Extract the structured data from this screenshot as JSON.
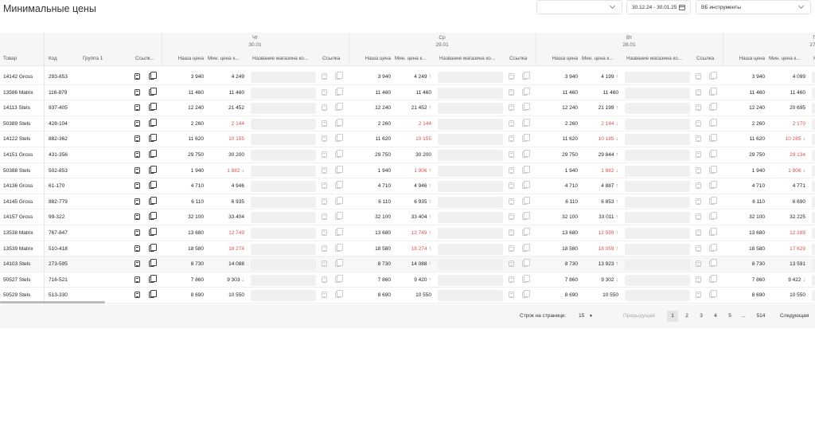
{
  "page": {
    "title": "Минимальные цены"
  },
  "filters": {
    "store_select": "",
    "date_range": "30.12.24 - 30.01.25",
    "category_select": "ВБ инструменты"
  },
  "icons": [
    "chevron-down-icon",
    "calendar-icon",
    "link-doc-icon",
    "copy-icon"
  ],
  "columns": {
    "product": "Товар",
    "code": "Код",
    "group": "Группа 1",
    "link": "Ссылк...",
    "our_price": "Наша цена",
    "min_price": "Мин. цена к...",
    "store_name": "Название магазина ко...",
    "store_link": "Ссылка"
  },
  "days": [
    {
      "name": "Чт",
      "date": "30.01"
    },
    {
      "name": "Ср",
      "date": "29.01"
    },
    {
      "name": "Вт",
      "date": "28.01"
    },
    {
      "name": "Пн",
      "date": "27.01"
    }
  ],
  "rows": [
    {
      "product": "14142 Gross",
      "code": "293-853",
      "d": [
        [
          "3 940",
          "4 249",
          ""
        ],
        [
          "3 940",
          "4 249",
          "↑"
        ],
        [
          "3 940",
          "4 199",
          "↑"
        ],
        [
          "3 940",
          "4 099",
          ""
        ]
      ],
      "red": [
        false,
        false,
        false,
        false
      ]
    },
    {
      "product": "13586 Matrix",
      "code": "116-879",
      "d": [
        [
          "11 460",
          "11 460",
          ""
        ],
        [
          "11 460",
          "11 460",
          ""
        ],
        [
          "11 460",
          "11 460",
          ""
        ],
        [
          "11 460",
          "11 460",
          ""
        ]
      ],
      "red": [
        false,
        false,
        false,
        false
      ]
    },
    {
      "product": "14113 Stels",
      "code": "937-405",
      "d": [
        [
          "12 240",
          "21 452",
          ""
        ],
        [
          "12 240",
          "21 452",
          "↑"
        ],
        [
          "12 240",
          "21 199",
          "↑"
        ],
        [
          "12 240",
          "20 695",
          ""
        ]
      ],
      "red": [
        false,
        false,
        false,
        false
      ]
    },
    {
      "product": "50389 Stels",
      "code": "428-104",
      "d": [
        [
          "2 260",
          "2 144",
          ""
        ],
        [
          "2 260",
          "2 144",
          ""
        ],
        [
          "2 260",
          "2 144",
          "↓"
        ],
        [
          "2 260",
          "2 170",
          ""
        ]
      ],
      "red": [
        true,
        true,
        true,
        true
      ]
    },
    {
      "product": "14122 Stels",
      "code": "882-362",
      "d": [
        [
          "11 620",
          "10 155",
          ""
        ],
        [
          "11 620",
          "10 155",
          ""
        ],
        [
          "11 620",
          "10 185",
          "↓"
        ],
        [
          "11 620",
          "10 285",
          "↓"
        ]
      ],
      "red": [
        true,
        true,
        true,
        true
      ]
    },
    {
      "product": "14151 Gross",
      "code": "431-356",
      "d": [
        [
          "29 750",
          "30 200",
          ""
        ],
        [
          "29 750",
          "30 200",
          ""
        ],
        [
          "29 750",
          "29 844",
          "↑"
        ],
        [
          "29 750",
          "29 134",
          ""
        ]
      ],
      "red": [
        false,
        false,
        false,
        true
      ]
    },
    {
      "product": "50388 Stels",
      "code": "502-853",
      "d": [
        [
          "1 940",
          "1 882",
          "↓"
        ],
        [
          "1 940",
          "1 906",
          "↑"
        ],
        [
          "1 940",
          "1 882",
          "↓"
        ],
        [
          "1 940",
          "1 906",
          "↓"
        ]
      ],
      "red": [
        true,
        true,
        true,
        true
      ]
    },
    {
      "product": "14136 Gross",
      "code": "61-170",
      "d": [
        [
          "4 710",
          "4 946",
          ""
        ],
        [
          "4 710",
          "4 946",
          "↑"
        ],
        [
          "4 710",
          "4 887",
          "↑"
        ],
        [
          "4 710",
          "4 771",
          ""
        ]
      ],
      "red": [
        false,
        false,
        false,
        false
      ]
    },
    {
      "product": "14145 Gross",
      "code": "882-779",
      "d": [
        [
          "6 110",
          "6 935",
          ""
        ],
        [
          "6 110",
          "6 935",
          "↑"
        ],
        [
          "6 110",
          "6 853",
          "↑"
        ],
        [
          "6 110",
          "6 690",
          ""
        ]
      ],
      "red": [
        false,
        false,
        false,
        false
      ]
    },
    {
      "product": "14157 Gross",
      "code": "99-322",
      "d": [
        [
          "32 100",
          "33 404",
          ""
        ],
        [
          "32 100",
          "33 404",
          "↑"
        ],
        [
          "32 100",
          "33 011",
          "↑"
        ],
        [
          "32 100",
          "32 225",
          ""
        ]
      ],
      "red": [
        false,
        false,
        false,
        false
      ]
    },
    {
      "product": "13538 Matrix",
      "code": "767-847",
      "d": [
        [
          "13 680",
          "12 749",
          ""
        ],
        [
          "13 680",
          "12 749",
          "↑"
        ],
        [
          "13 680",
          "12 599",
          "↑"
        ],
        [
          "13 680",
          "12 289",
          ""
        ]
      ],
      "red": [
        true,
        true,
        true,
        true
      ]
    },
    {
      "product": "13539 Matrix",
      "code": "510-418",
      "d": [
        [
          "18 580",
          "18 274",
          ""
        ],
        [
          "18 580",
          "18 274",
          "↑"
        ],
        [
          "18 580",
          "18 059",
          "↑"
        ],
        [
          "18 580",
          "17 629",
          ""
        ]
      ],
      "red": [
        true,
        true,
        true,
        true
      ]
    },
    {
      "product": "14103 Stels",
      "code": "273-595",
      "d": [
        [
          "8 730",
          "14 088",
          ""
        ],
        [
          "8 730",
          "14 088",
          "↑"
        ],
        [
          "8 730",
          "13 923",
          "↑"
        ],
        [
          "8 730",
          "13 591",
          ""
        ]
      ],
      "red": [
        false,
        false,
        false,
        false
      ]
    },
    {
      "product": "50527 Stels",
      "code": "716-521",
      "d": [
        [
          "7 860",
          "9 303",
          "↓"
        ],
        [
          "7 860",
          "9 420",
          "↑"
        ],
        [
          "7 860",
          "9 302",
          "↓"
        ],
        [
          "7 860",
          "9 422",
          "↓"
        ]
      ],
      "red": [
        false,
        false,
        false,
        false
      ]
    },
    {
      "product": "50529 Stels",
      "code": "513-330",
      "d": [
        [
          "8 690",
          "10 550",
          ""
        ],
        [
          "8 690",
          "10 550",
          ""
        ],
        [
          "8 690",
          "10 550",
          ""
        ],
        [
          "8 690",
          "10 550",
          ""
        ]
      ],
      "red": [
        false,
        false,
        false,
        false
      ]
    }
  ],
  "pagination": {
    "rows_per_page_label": "Строк на странице:",
    "rows_per_page": "15",
    "prev": "Предыдущая",
    "pages": [
      "1",
      "2",
      "3",
      "4",
      "5",
      "...",
      "514"
    ],
    "next": "Следующая"
  }
}
